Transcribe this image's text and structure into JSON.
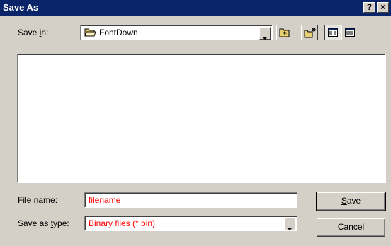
{
  "window": {
    "title": "Save As",
    "help_label": "?",
    "close_label": "×"
  },
  "save_in": {
    "label_before": "Save ",
    "label_accel": "i",
    "label_after": "n:",
    "value": "FontDown"
  },
  "toolbar": {
    "icons": [
      "up-one-level-icon",
      "create-new-folder-icon",
      "list-view-icon",
      "details-view-icon"
    ]
  },
  "file_name": {
    "label_before": "File ",
    "label_accel": "n",
    "label_after": "ame:",
    "value": "filename"
  },
  "save_as_type": {
    "label_before": "Save as ",
    "label_accel": "t",
    "label_after": "ype:",
    "value": "Binary files (*.bin)"
  },
  "buttons": {
    "save_accel": "S",
    "save_rest": "ave",
    "cancel": "Cancel"
  },
  "colors": {
    "titlebar": "#0a246a",
    "face": "#d4d0c8",
    "value_text": "#ff0000"
  }
}
